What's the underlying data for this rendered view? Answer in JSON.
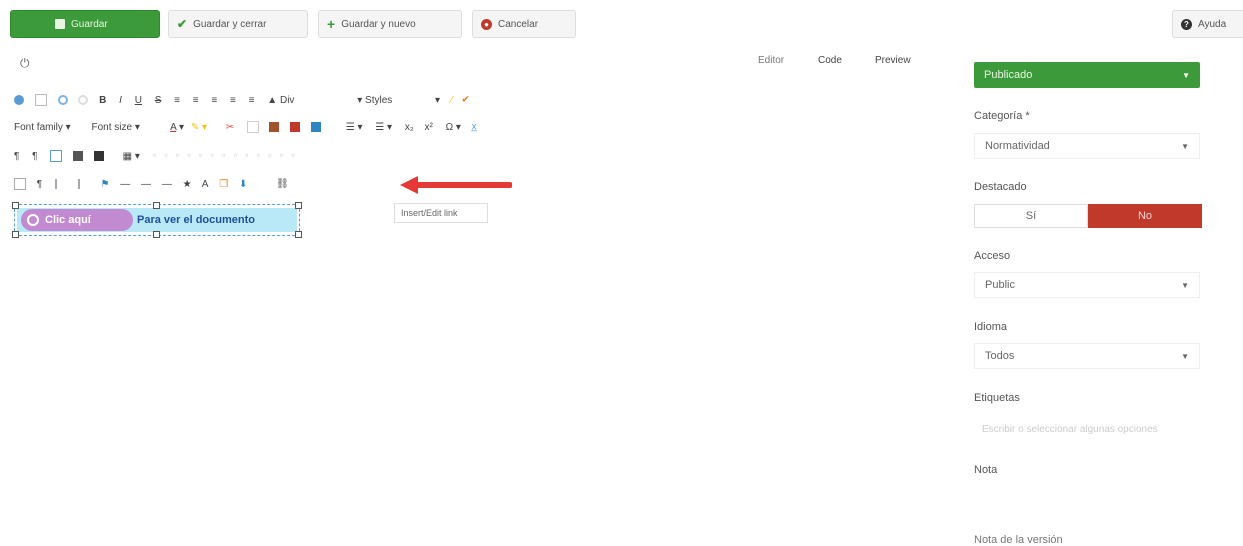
{
  "toolbar": {
    "save": "Guardar",
    "save_close": "Guardar y cerrar",
    "save_new": "Guardar y nuevo",
    "cancel": "Cancelar",
    "help": "Ayuda"
  },
  "editor": {
    "tabs": [
      "Editor",
      "Code",
      "Preview"
    ],
    "format_select": "Div",
    "styles_select": "Styles",
    "font_family": "Font family",
    "font_size": "Font size",
    "tooltip": "Insert/Edit link",
    "content": {
      "badge": "Clic aquí",
      "text": "Para ver el documento"
    }
  },
  "sidebar": {
    "status": "Publicado",
    "category_label": "Categoría *",
    "category_value": "Normatividad",
    "featured_label": "Destacado",
    "featured_yes": "Sí",
    "featured_no": "No",
    "access_label": "Acceso",
    "access_value": "Public",
    "language_label": "Idioma",
    "language_value": "Todos",
    "tags_label": "Etiquetas",
    "tags_placeholder": "Escribir o seleccionar algunas opciones",
    "note_label": "Nota",
    "version_note_label": "Nota de la versión"
  },
  "colors": {
    "green": "#3d9a3a",
    "red": "#c0392b",
    "badge_bg": "#c28ad0",
    "highlight_bg": "#b9e9f7",
    "arrow": "#e53935"
  }
}
